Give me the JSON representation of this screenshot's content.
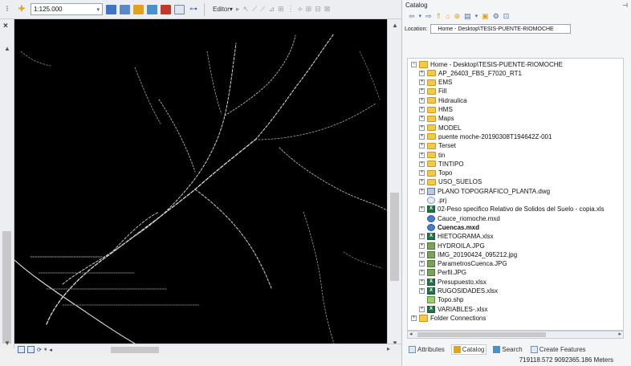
{
  "toolbar": {
    "scale_value": "1:125.000",
    "editor_label": "Editor▾"
  },
  "catalog": {
    "title": "Catalog",
    "pin_icon": "pin-icon",
    "location_label": "Location:",
    "location_value": "Home - Desktop\\TESIS-PUENTE-RIOMOCHE",
    "tree": [
      {
        "label": "Home - Desktop\\TESIS-PUENTE-RIOMOCHE",
        "icon": "home-folder-icon",
        "level": 0,
        "expander": "minus"
      },
      {
        "label": "AP_26403_FBS_F7020_RT1",
        "icon": "folder-icon",
        "level": 1,
        "expander": "plus"
      },
      {
        "label": "EMS",
        "icon": "folder-icon",
        "level": 1,
        "expander": "plus"
      },
      {
        "label": "Fill",
        "icon": "folder-icon",
        "level": 1,
        "expander": "plus"
      },
      {
        "label": "Hidraulica",
        "icon": "folder-icon",
        "level": 1,
        "expander": "plus"
      },
      {
        "label": "HMS",
        "icon": "folder-icon",
        "level": 1,
        "expander": "plus"
      },
      {
        "label": "Maps",
        "icon": "folder-icon",
        "level": 1,
        "expander": "plus"
      },
      {
        "label": "MODEL",
        "icon": "folder-icon",
        "level": 1,
        "expander": "plus"
      },
      {
        "label": "puente moche-20190308T194642Z-001",
        "icon": "folder-icon",
        "level": 1,
        "expander": "plus"
      },
      {
        "label": "Terset",
        "icon": "folder-icon",
        "level": 1,
        "expander": "plus"
      },
      {
        "label": "tin",
        "icon": "folder-icon",
        "level": 1,
        "expander": "plus"
      },
      {
        "label": "TINTIPO",
        "icon": "folder-icon",
        "level": 1,
        "expander": "plus"
      },
      {
        "label": "Topo",
        "icon": "folder-icon",
        "level": 1,
        "expander": "plus"
      },
      {
        "label": "USO_SUELOS",
        "icon": "folder-icon",
        "level": 1,
        "expander": "plus"
      },
      {
        "label": "PLANO TOPOGRÁFICO_PLANTA.dwg",
        "icon": "dwg-icon",
        "level": 1,
        "expander": "plus"
      },
      {
        "label": ".prj",
        "icon": "prj-icon",
        "level": 1,
        "expander": "none"
      },
      {
        "label": "02-Peso specifico Relativo de Solidos del Suelo - copia.xls",
        "icon": "excel-icon",
        "level": 1,
        "expander": "plus"
      },
      {
        "label": "Cauce_riomoche.mxd",
        "icon": "mxd-icon",
        "level": 1,
        "expander": "none"
      },
      {
        "label": "Cuencas.mxd",
        "icon": "mxd-icon",
        "level": 1,
        "expander": "none",
        "bold": true
      },
      {
        "label": "HIETOGRAMA.xlsx",
        "icon": "excel-icon",
        "level": 1,
        "expander": "plus"
      },
      {
        "label": "HYDROILA.JPG",
        "icon": "image-icon",
        "level": 1,
        "expander": "plus"
      },
      {
        "label": "IMG_20190424_095212.jpg",
        "icon": "image-icon",
        "level": 1,
        "expander": "plus"
      },
      {
        "label": "ParametrosCuenca.JPG",
        "icon": "image-icon",
        "level": 1,
        "expander": "plus"
      },
      {
        "label": "Perfil.JPG",
        "icon": "image-icon",
        "level": 1,
        "expander": "plus"
      },
      {
        "label": "Presupuesto.xlsx",
        "icon": "excel-icon",
        "level": 1,
        "expander": "plus"
      },
      {
        "label": "RUGOSIDADES.xlsx",
        "icon": "excel-icon",
        "level": 1,
        "expander": "plus"
      },
      {
        "label": "Topo.shp",
        "icon": "shapefile-icon",
        "level": 1,
        "expander": "none"
      },
      {
        "label": "VARIABLES-.xlsx",
        "icon": "excel-icon",
        "level": 1,
        "expander": "plus"
      },
      {
        "label": "Folder Connections",
        "icon": "folder-connections-icon",
        "level": 0,
        "expander": "plus"
      }
    ],
    "tabs": [
      {
        "label": "Attributes",
        "active": false
      },
      {
        "label": "Catalog",
        "active": true
      },
      {
        "label": "Search",
        "active": false
      },
      {
        "label": "Create Features",
        "active": false
      }
    ]
  },
  "status": {
    "coordinates": "719118.572  9092365.186 Meters"
  }
}
